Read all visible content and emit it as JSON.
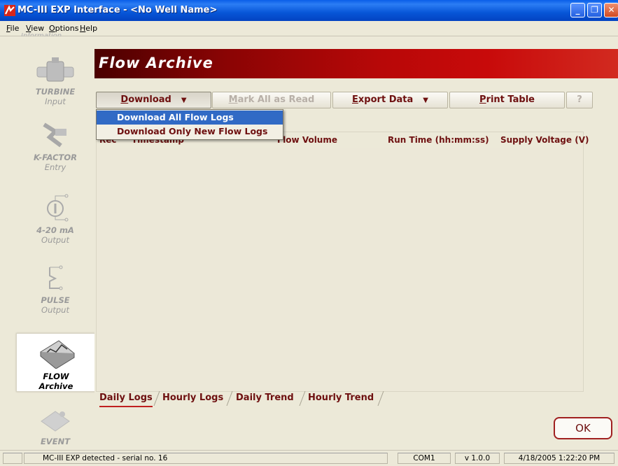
{
  "window": {
    "title": "MC-III EXP Interface - <No Well Name>",
    "accent": "#0a5ee8",
    "icons": [
      "app-logo-icon",
      "minimize-icon",
      "maximize-icon",
      "close-icon"
    ]
  },
  "menu": {
    "file": {
      "ul": "F",
      "rest": "ile"
    },
    "view": {
      "ul": "V",
      "rest": "iew"
    },
    "options": {
      "ul": "O",
      "rest": "ptions"
    },
    "help": {
      "ul": "H",
      "rest": "elp"
    }
  },
  "sidebar": {
    "top_clipped": "Information",
    "items": [
      {
        "main": "TURBINE",
        "sub": "Input",
        "icon": "turbine-icon"
      },
      {
        "main": "K-FACTOR",
        "sub": "Entry",
        "icon": "k-factor-icon"
      },
      {
        "main": "4-20 mA",
        "sub": "Output",
        "icon": "analog-output-icon"
      },
      {
        "main": "PULSE",
        "sub": "Output",
        "icon": "pulse-output-icon"
      },
      {
        "main": "FLOW",
        "sub": "Archive",
        "icon": "flow-archive-icon"
      },
      {
        "main": "EVENT",
        "sub": "",
        "icon": "event-icon"
      }
    ]
  },
  "header": {
    "title": "Flow Archive",
    "color": "#b80808"
  },
  "toolbar": {
    "download": {
      "ul": "D",
      "rest": "ownload",
      "arrow": "▼"
    },
    "mark_all": {
      "ul": "M",
      "rest": "ark All as Read"
    },
    "export": {
      "ul": "E",
      "rest": "xport Data",
      "arrow": "▼"
    },
    "print": {
      "ul": "P",
      "rest": "rint Table"
    },
    "help": "?"
  },
  "download_menu": {
    "items": [
      "Download All Flow Logs",
      "Download Only New Flow Logs"
    ]
  },
  "table": {
    "columns": [
      "Rec",
      "Timestamp",
      "Flow Volume",
      "Run Time (hh:mm:ss)",
      "Supply Voltage (V)"
    ],
    "rows": []
  },
  "tabs": [
    "Daily Logs",
    "Hourly Logs",
    "Daily Trend",
    "Hourly Trend"
  ],
  "ok_label": "OK",
  "status": {
    "message": "MC-III EXP detected - serial no. 16",
    "port": "COM1",
    "version": "v 1.0.0",
    "datetime": "4/18/2005 1:22:20 PM"
  }
}
